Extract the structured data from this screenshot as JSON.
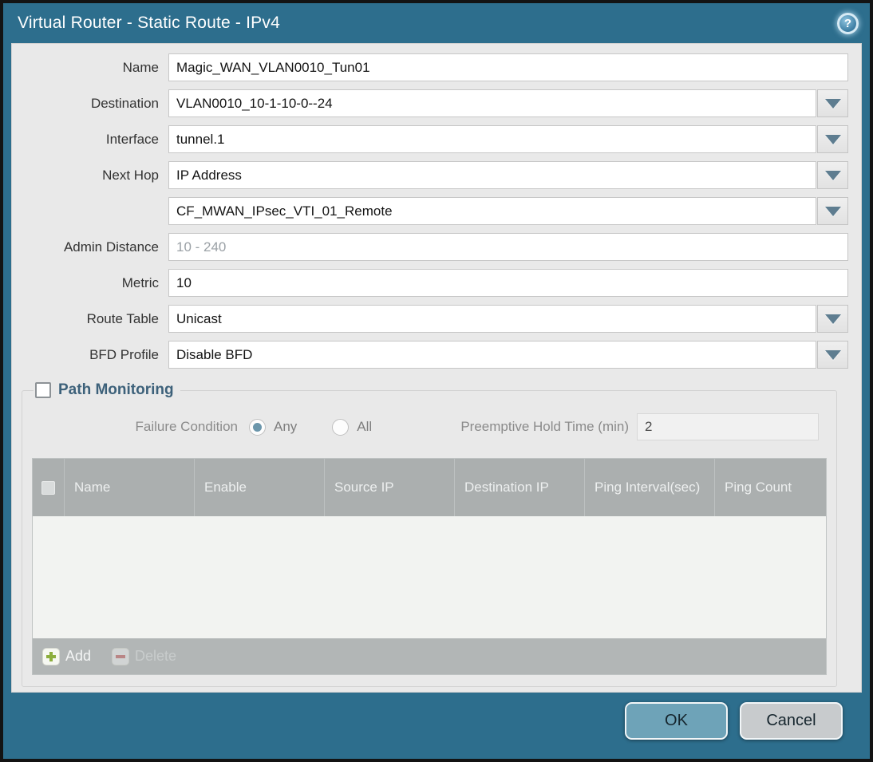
{
  "titlebar": {
    "title": "Virtual Router - Static Route - IPv4",
    "help_glyph": "?"
  },
  "form": {
    "rows": [
      {
        "label": "Name",
        "value": "Magic_WAN_VLAN0010_Tun01"
      },
      {
        "label": "Destination",
        "value": "VLAN0010_10-1-10-0--24"
      },
      {
        "label": "Interface",
        "value": "tunnel.1"
      },
      {
        "label": "Next Hop",
        "value": "IP Address"
      },
      {
        "label": "",
        "value": "CF_MWAN_IPsec_VTI_01_Remote"
      },
      {
        "label": "Admin Distance",
        "value": "",
        "placeholder": "10 - 240"
      },
      {
        "label": "Metric",
        "value": "10"
      },
      {
        "label": "Route Table",
        "value": "Unicast"
      },
      {
        "label": "BFD Profile",
        "value": "Disable BFD"
      }
    ]
  },
  "path_monitoring": {
    "title": "Path Monitoring",
    "checkbox_checked": false,
    "failure_condition": {
      "label": "Failure Condition",
      "options": [
        {
          "label": "Any",
          "selected": true
        },
        {
          "label": "All",
          "selected": false
        }
      ]
    },
    "preemptive_hold_time": {
      "label": "Preemptive Hold Time (min)",
      "value": "2"
    },
    "table": {
      "columns": [
        "Name",
        "Enable",
        "Source IP",
        "Destination IP",
        "Ping Interval(sec)",
        "Ping Count"
      ],
      "rows": []
    },
    "actions": {
      "add": "Add",
      "delete": "Delete"
    }
  },
  "footer": {
    "ok": "OK",
    "cancel": "Cancel"
  },
  "colors": {
    "titlebar_teal": "#2d6e8d",
    "panel_gray": "#e9e9e9",
    "table_header_gray": "#abafaf",
    "radio_selected": "#6b96ab",
    "add_green": "#8cae3e",
    "delete_red": "#c06060",
    "ok_button": "#6ea3b8",
    "cancel_button": "#c8cbcd"
  }
}
